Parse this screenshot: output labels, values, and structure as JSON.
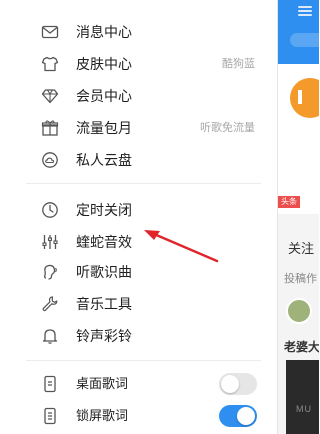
{
  "menu": {
    "group1": [
      {
        "icon": "mail-icon",
        "label": "消息中心",
        "hint": ""
      },
      {
        "icon": "shirt-icon",
        "label": "皮肤中心",
        "hint": "酷狗蓝"
      },
      {
        "icon": "diamond-icon",
        "label": "会员中心",
        "hint": ""
      },
      {
        "icon": "gift-icon",
        "label": "流量包月",
        "hint": "听歌免流量"
      },
      {
        "icon": "cloud-disk-icon",
        "label": "私人云盘",
        "hint": ""
      }
    ],
    "group2": [
      {
        "icon": "timer-icon",
        "label": "定时关闭"
      },
      {
        "icon": "equalizer-icon",
        "label": "蝰蛇音效"
      },
      {
        "icon": "recognize-song-icon",
        "label": "听歌识曲"
      },
      {
        "icon": "wrench-icon",
        "label": "音乐工具"
      },
      {
        "icon": "bell-icon",
        "label": "铃声彩铃"
      }
    ],
    "group3": [
      {
        "icon": "desktop-lyrics-icon",
        "label": "桌面歌词",
        "toggle": false
      },
      {
        "icon": "lockscreen-lyrics-icon",
        "label": "锁屏歌词",
        "toggle": true
      }
    ]
  },
  "background": {
    "tag": "头条",
    "text1": "关注",
    "text2": "投稿作",
    "text3": "老婆大",
    "dark_text": "MU"
  },
  "colors": {
    "accent": "#2f8ff0",
    "annotation_arrow": "#e0242a",
    "toggle_off": "#e6e6e6"
  }
}
